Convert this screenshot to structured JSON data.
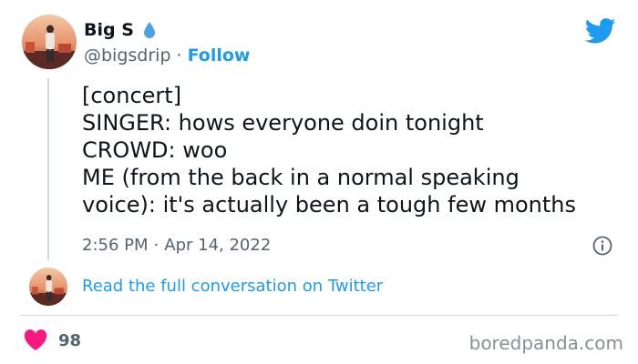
{
  "user": {
    "display_name": "Big S",
    "handle": "@bigsdrip",
    "separator": "·",
    "follow_label": "Follow"
  },
  "tweet": {
    "lines": [
      "[concert]",
      "SINGER: hows everyone doin tonight",
      "CROWD: woo",
      "ME (from the back in a normal speaking",
      "voice): it's actually been a tough few months"
    ],
    "time": "2:56 PM",
    "separator": "·",
    "date": "Apr 14, 2022"
  },
  "conversation_link": "Read the full conversation on Twitter",
  "likes": {
    "count": "98"
  },
  "watermark": "boredpanda.com",
  "icons": {
    "verified": "water-drop-icon",
    "brand": "twitter-bird-icon",
    "info": "info-icon",
    "like": "heart-icon"
  },
  "colors": {
    "accent": "#1d9bf0",
    "text": "#0f1419",
    "muted": "#536471",
    "heart": "#f91880",
    "divider": "#cfd9de"
  }
}
